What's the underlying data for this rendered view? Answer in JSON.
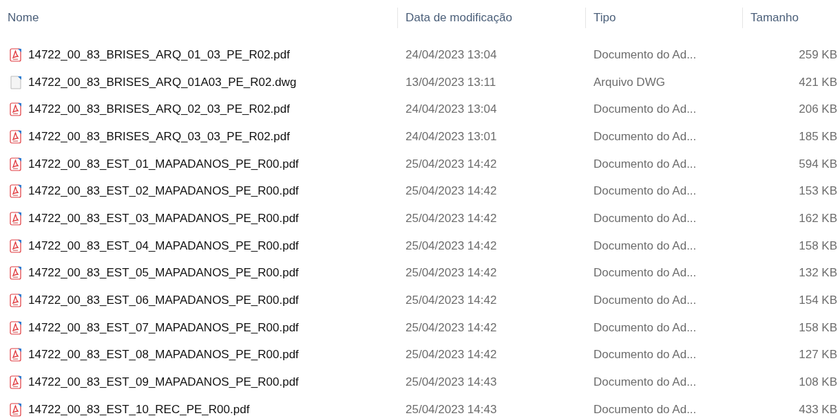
{
  "columns": [
    "Nome",
    "Data de modificação",
    "Tipo",
    "Tamanho"
  ],
  "files": [
    {
      "kind": "pdf",
      "name": "14722_00_83_BRISES_ARQ_01_03_PE_R02.pdf",
      "modified": "24/04/2023 13:04",
      "type": "Documento do Ad...",
      "size": "259 KB"
    },
    {
      "kind": "dwg",
      "name": "14722_00_83_BRISES_ARQ_01A03_PE_R02.dwg",
      "modified": "13/04/2023 13:11",
      "type": "Arquivo DWG",
      "size": "421 KB"
    },
    {
      "kind": "pdf",
      "name": "14722_00_83_BRISES_ARQ_02_03_PE_R02.pdf",
      "modified": "24/04/2023 13:04",
      "type": "Documento do Ad...",
      "size": "206 KB"
    },
    {
      "kind": "pdf",
      "name": "14722_00_83_BRISES_ARQ_03_03_PE_R02.pdf",
      "modified": "24/04/2023 13:01",
      "type": "Documento do Ad...",
      "size": "185 KB"
    },
    {
      "kind": "pdf",
      "name": "14722_00_83_EST_01_MAPADANOS_PE_R00.pdf",
      "modified": "25/04/2023 14:42",
      "type": "Documento do Ad...",
      "size": "594 KB"
    },
    {
      "kind": "pdf",
      "name": "14722_00_83_EST_02_MAPADANOS_PE_R00.pdf",
      "modified": "25/04/2023 14:42",
      "type": "Documento do Ad...",
      "size": "153 KB"
    },
    {
      "kind": "pdf",
      "name": "14722_00_83_EST_03_MAPADANOS_PE_R00.pdf",
      "modified": "25/04/2023 14:42",
      "type": "Documento do Ad...",
      "size": "162 KB"
    },
    {
      "kind": "pdf",
      "name": "14722_00_83_EST_04_MAPADANOS_PE_R00.pdf",
      "modified": "25/04/2023 14:42",
      "type": "Documento do Ad...",
      "size": "158 KB"
    },
    {
      "kind": "pdf",
      "name": "14722_00_83_EST_05_MAPADANOS_PE_R00.pdf",
      "modified": "25/04/2023 14:42",
      "type": "Documento do Ad...",
      "size": "132 KB"
    },
    {
      "kind": "pdf",
      "name": "14722_00_83_EST_06_MAPADANOS_PE_R00.pdf",
      "modified": "25/04/2023 14:42",
      "type": "Documento do Ad...",
      "size": "154 KB"
    },
    {
      "kind": "pdf",
      "name": "14722_00_83_EST_07_MAPADANOS_PE_R00.pdf",
      "modified": "25/04/2023 14:42",
      "type": "Documento do Ad...",
      "size": "158 KB"
    },
    {
      "kind": "pdf",
      "name": "14722_00_83_EST_08_MAPADANOS_PE_R00.pdf",
      "modified": "25/04/2023 14:42",
      "type": "Documento do Ad...",
      "size": "127 KB"
    },
    {
      "kind": "pdf",
      "name": "14722_00_83_EST_09_MAPADANOS_PE_R00.pdf",
      "modified": "25/04/2023 14:43",
      "type": "Documento do Ad...",
      "size": "108 KB"
    },
    {
      "kind": "pdf",
      "name": "14722_00_83_EST_10_REC_PE_R00.pdf",
      "modified": "25/04/2023 14:43",
      "type": "Documento do Ad...",
      "size": "433 KB"
    }
  ]
}
